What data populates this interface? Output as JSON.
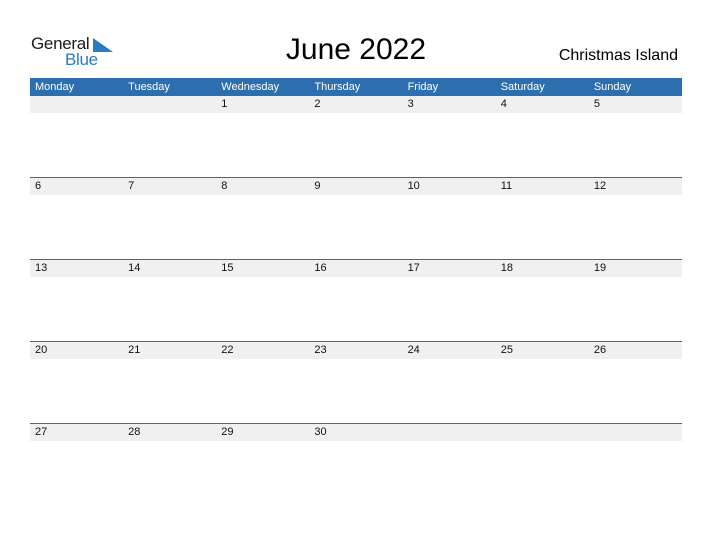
{
  "logo": {
    "word1": "General",
    "word2": "Blue"
  },
  "title": "June 2022",
  "region": "Christmas Island",
  "weekdays": [
    "Monday",
    "Tuesday",
    "Wednesday",
    "Thursday",
    "Friday",
    "Saturday",
    "Sunday"
  ],
  "weeks": [
    [
      "",
      "",
      "1",
      "2",
      "3",
      "4",
      "5"
    ],
    [
      "6",
      "7",
      "8",
      "9",
      "10",
      "11",
      "12"
    ],
    [
      "13",
      "14",
      "15",
      "16",
      "17",
      "18",
      "19"
    ],
    [
      "20",
      "21",
      "22",
      "23",
      "24",
      "25",
      "26"
    ],
    [
      "27",
      "28",
      "29",
      "30",
      "",
      "",
      ""
    ]
  ],
  "colors": {
    "header": "#2d6fae",
    "brand_blue": "#2a7bc4",
    "date_strip": "#f0f0f0"
  }
}
